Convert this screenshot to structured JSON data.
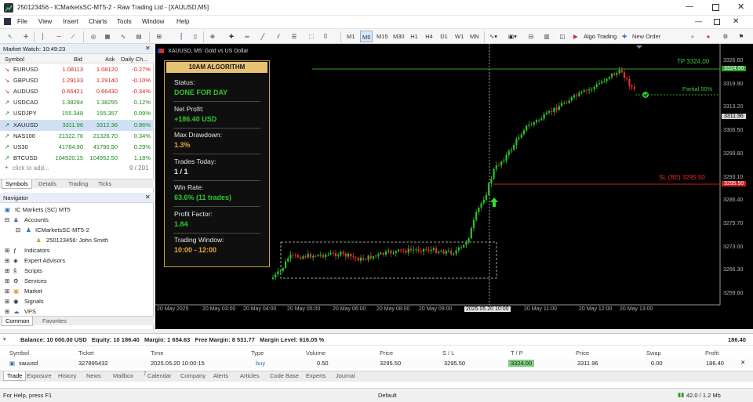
{
  "app": {
    "title": "250123456 - ICMarketsSC-MT5-2 - Raw Trading Ltd - [XAUUSD,M5]"
  },
  "menu": [
    "File",
    "View",
    "Insert",
    "Charts",
    "Tools",
    "Window",
    "Help"
  ],
  "toolbar": {
    "timeframes": [
      "M1",
      "M5",
      "M15",
      "M30",
      "H1",
      "H4",
      "D1",
      "W1",
      "MN"
    ],
    "algo": "Algo Trading",
    "neworder": "New Order"
  },
  "marketwatch": {
    "title": "Market Watch: 10:49:23",
    "cols": [
      "Symbol",
      "Bid",
      "Ask",
      "Daily Ch..."
    ],
    "rows": [
      {
        "s": "EURUSD",
        "b": "1.08113",
        "a": "1.08120",
        "c": "-0.27%"
      },
      {
        "s": "GBPUSD",
        "b": "1.29133",
        "a": "1.29140",
        "c": "-0.10%"
      },
      {
        "s": "AUDUSD",
        "b": "0.66421",
        "a": "0.66430",
        "c": "-0.34%"
      },
      {
        "s": "USDCAD",
        "b": "1.38284",
        "a": "1.38295",
        "c": "0.12%"
      },
      {
        "s": "USDJPY",
        "b": "155.348",
        "a": "155.357",
        "c": "0.09%"
      },
      {
        "s": "XAUUSD",
        "b": "3311.96",
        "a": "3312.36",
        "c": "0.86%"
      },
      {
        "s": "NAS100",
        "b": "21322.70",
        "a": "21326.70",
        "c": "0.34%"
      },
      {
        "s": "US30",
        "b": "41784.90",
        "a": "41790.90",
        "c": "0.29%"
      },
      {
        "s": "BTCUSD",
        "b": "104920.15",
        "a": "104952.50",
        "c": "1.18%"
      }
    ],
    "add": "click to add...",
    "count": "9 / 201",
    "tabs": [
      "Symbols",
      "Details",
      "Trading",
      "Ticks"
    ]
  },
  "navigator": {
    "title": "Navigator",
    "root": "IC Markets (SC) MT5",
    "accounts": "Accounts",
    "server": "ICMarketsSC-MT5-2",
    "user": "250123456: John Smith",
    "items": [
      "Indicators",
      "Expert Advisors",
      "Scripts",
      "Services",
      "Market",
      "Signals",
      "VPS"
    ],
    "tabs": [
      "Common",
      "Favorites"
    ]
  },
  "chart": {
    "symbol_title": "XAUUSD, M5:  Gold vs US Dollar",
    "tp": "TP 3324.00",
    "tp_tag": "3324.00",
    "sl": "SL (BE) 3295.50",
    "sl_tag": "3295.50",
    "partial": "Partial 50%",
    "price_tag": "3311.96",
    "yticks": [
      "3326.60",
      "3319.90",
      "3313.20",
      "3306.50",
      "3299.80",
      "3293.10",
      "3286.40",
      "3279.70",
      "3273.00",
      "3266.30",
      "3259.60"
    ],
    "xticks": [
      "20 May 2025",
      "20 May 03:00",
      "20 May 04:00",
      "20 May 05:00",
      "20 May 06:00",
      "20 May 08:00",
      "20 May 09:00",
      "2025.05.20 10:00",
      "20 May 11:00",
      "20 May 12:00",
      "20 May 13:00"
    ]
  },
  "algo": {
    "title": "10AM ALGORITHM",
    "items": [
      {
        "k": "Status:",
        "v": "DONE FOR DAY",
        "c": "#2ec82e"
      },
      {
        "k": "Net Profit:",
        "v": "+186.40 USD",
        "c": "#2ec82e"
      },
      {
        "k": "Max Drawdown:",
        "v": "1.3%",
        "c": "#e6a93a"
      },
      {
        "k": "Trades Today:",
        "v": "1 / 1",
        "c": "#e8e8e8"
      },
      {
        "k": "Win Rate:",
        "v": "63.6% (11 trades)",
        "c": "#2ec82e"
      },
      {
        "k": "Profit Factor:",
        "v": "1.84",
        "c": "#2ec82e"
      },
      {
        "k": "Trading Window:",
        "v": "10:00 - 12:00",
        "c": "#e6a93a"
      }
    ]
  },
  "account": {
    "summary": "Balance: 10 000.00 USD   Equity: 10 186.40   Margin: 1 654.63   Free Margin: 8 531.77   Margin Level: 616.05 %",
    "total": "186.40"
  },
  "trades": {
    "cols": [
      "Symbol",
      "Ticket",
      "Time",
      "Type",
      "Volume",
      "Price",
      "S / L",
      "T / P",
      "Price",
      "Swap",
      "Profit"
    ],
    "rows": [
      {
        "symbol": "xauusd",
        "ticket": "327895432",
        "time": "2025.05.20 10:00:15",
        "type": "buy",
        "volume": "0.50",
        "price": "3295.50",
        "sl": "3295.50",
        "tp": "3324.00",
        "cur": "3311.96",
        "swap": "0.00",
        "profit": "186.40"
      }
    ],
    "tabs": [
      "Trade",
      "Exposure",
      "History",
      "News",
      "Mailbox",
      "Calendar",
      "Company",
      "Alerts",
      "Articles",
      "Code Base",
      "Experts",
      "Journal"
    ],
    "mailbox_badge": "7"
  },
  "status": {
    "help": "For Help, press F1",
    "profile": "Default",
    "net": "42.0 / 1.2 Mb"
  }
}
